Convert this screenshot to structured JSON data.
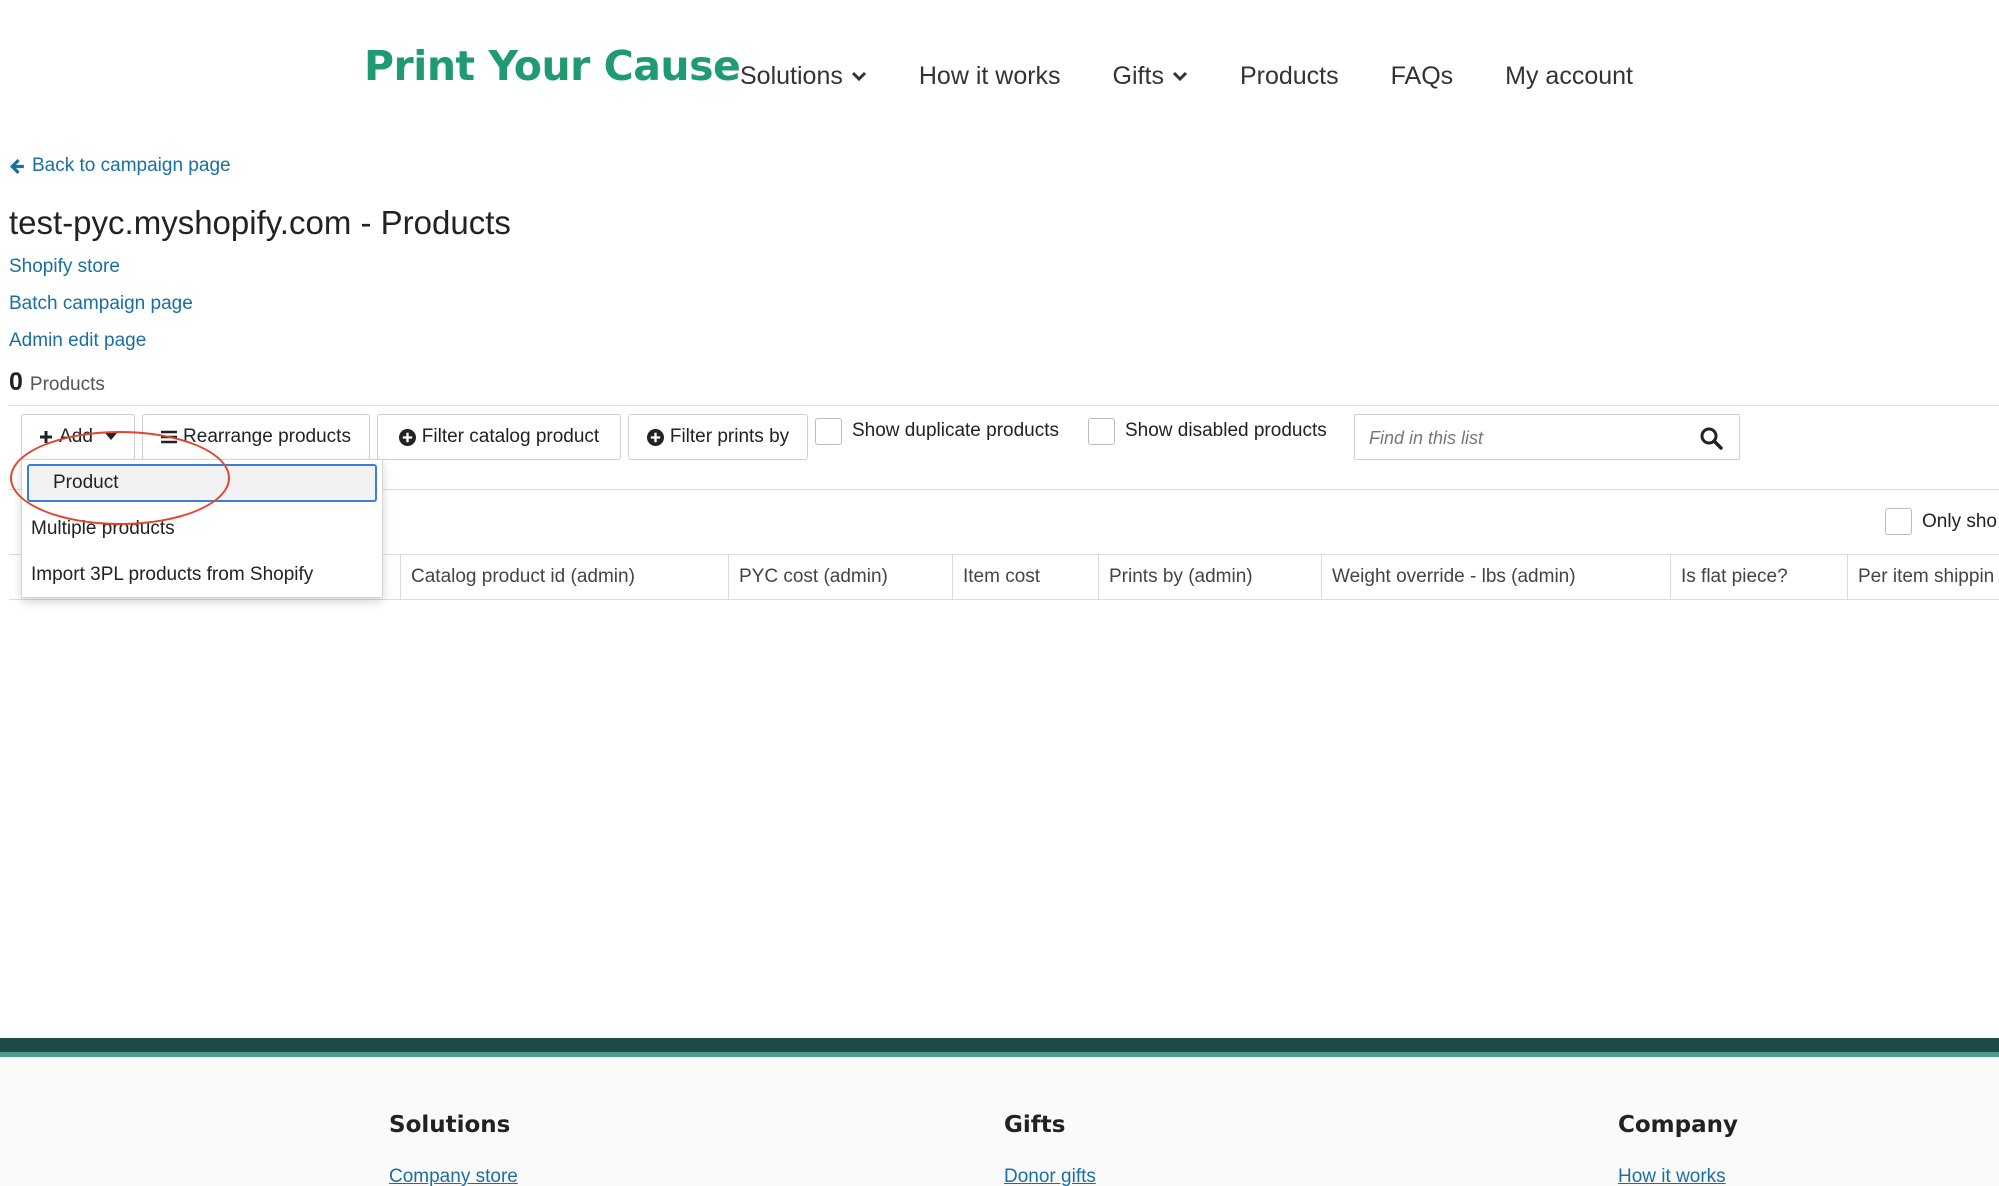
{
  "header": {
    "logo": "Print Your Cause",
    "nav": [
      {
        "label": "Solutions",
        "has_dropdown": true
      },
      {
        "label": "How it works",
        "has_dropdown": false
      },
      {
        "label": "Gifts",
        "has_dropdown": true
      },
      {
        "label": "Products",
        "has_dropdown": false
      },
      {
        "label": "FAQs",
        "has_dropdown": false
      },
      {
        "label": "My account",
        "has_dropdown": false
      }
    ]
  },
  "page": {
    "back_link": "Back to campaign page",
    "title": "test-pyc.myshopify.com - Products",
    "links": [
      "Shopify store",
      "Batch campaign page",
      "Admin edit page"
    ],
    "count": "0",
    "count_label": "Products"
  },
  "toolbar": {
    "add_label": "Add",
    "rearrange_label": "Rearrange products",
    "filter_catalog_label": "Filter catalog product",
    "filter_prints_label": "Filter prints by",
    "show_duplicates_label": "Show duplicate products",
    "show_disabled_label": "Show disabled products",
    "search_placeholder": "Find in this list",
    "only_show_label": "Only sho"
  },
  "add_menu": {
    "items": [
      "Product",
      "Multiple products",
      "Import 3PL products from Shopify"
    ],
    "selected_index": 0
  },
  "table": {
    "columns": [
      "Catalog product id (admin)",
      "PYC cost (admin)",
      "Item cost",
      "Prints by (admin)",
      "Weight override - lbs (admin)",
      "Is flat piece?",
      "Per item shippin"
    ]
  },
  "footer": {
    "columns": [
      {
        "heading": "Solutions",
        "link": "Company store"
      },
      {
        "heading": "Gifts",
        "link": "Donor gifts"
      },
      {
        "heading": "Company",
        "link": "How it works"
      }
    ]
  },
  "colors": {
    "brand_green": "#1f9a73",
    "link_blue": "#1a6fa0",
    "footer_dark": "#1d4a4a",
    "annotation_red": "#e0462f"
  }
}
